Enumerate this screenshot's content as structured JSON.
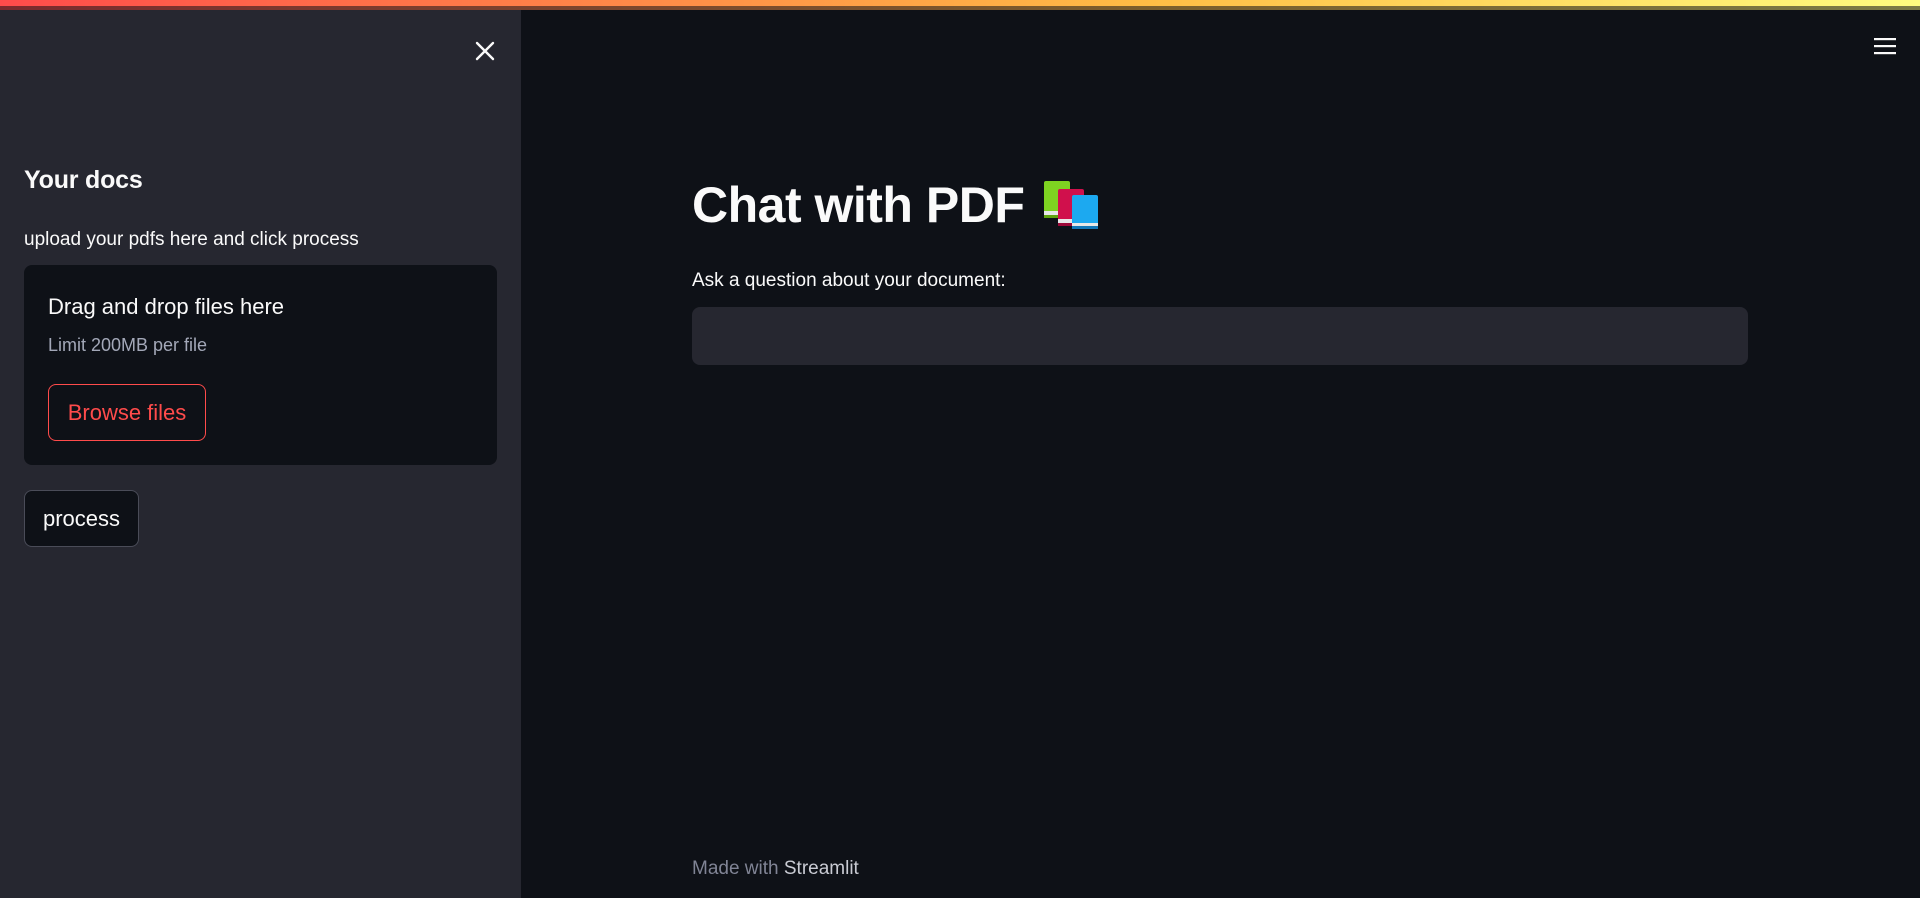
{
  "sidebar": {
    "heading": "Your docs",
    "caption": "upload your pdfs here and click process",
    "uploader": {
      "title": "Drag and drop files here",
      "limit": "Limit 200MB per file",
      "browse_label": "Browse files"
    },
    "process_label": "process"
  },
  "main": {
    "title": "Chat with PDF",
    "title_icon": "books-icon",
    "question_label": "Ask a question about your document:",
    "question_value": ""
  },
  "footer": {
    "prefix": "Made with ",
    "link": "Streamlit"
  },
  "colors": {
    "accent": "#ff4b4b",
    "background": "#0e1117",
    "sidebar": "#262730"
  }
}
